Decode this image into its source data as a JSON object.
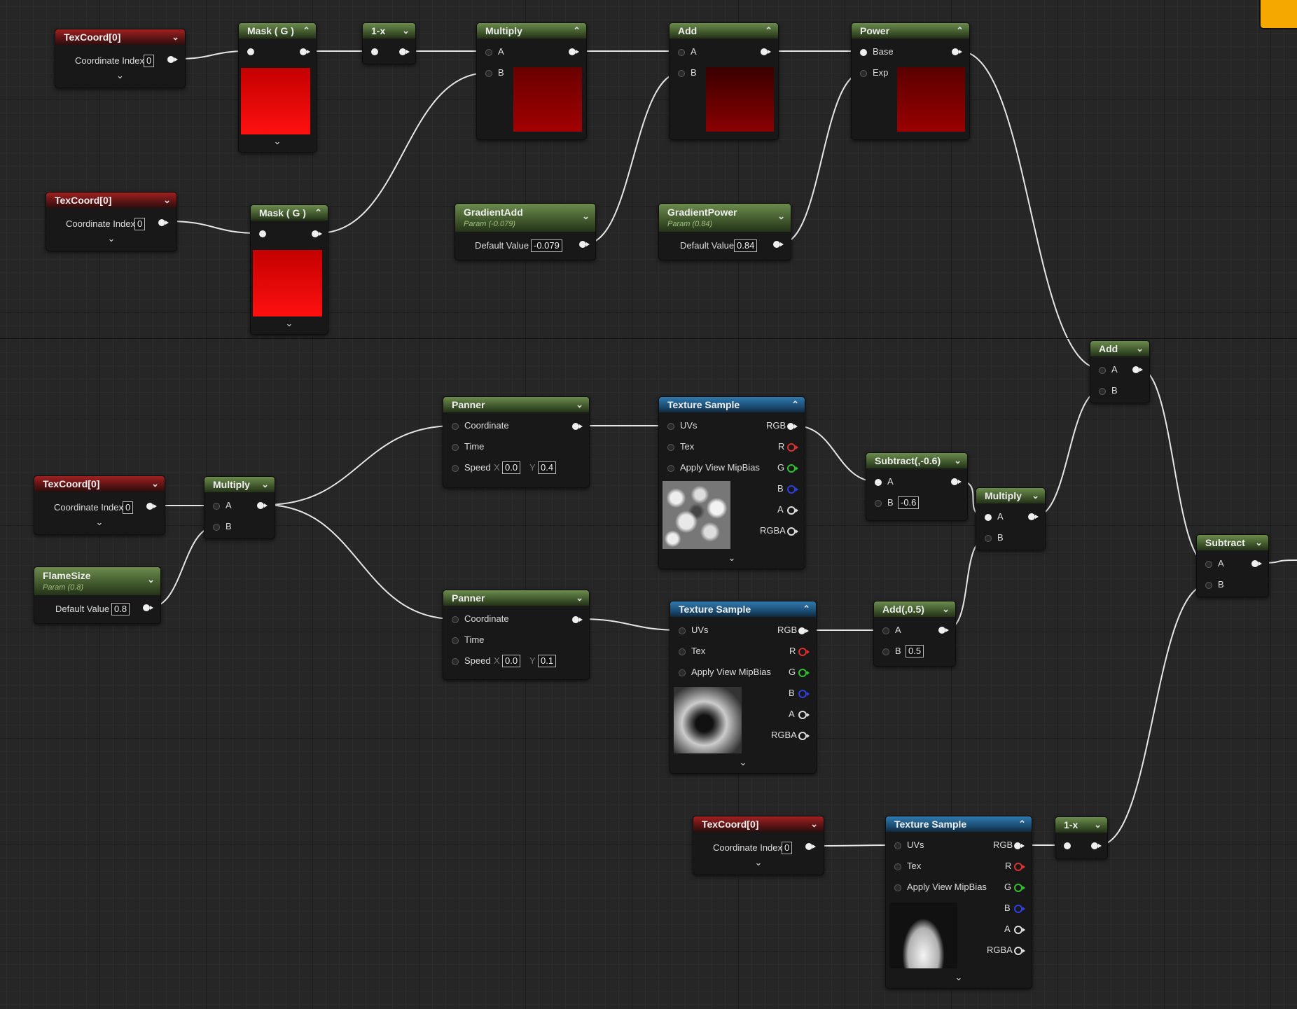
{
  "colors": {
    "accent_swatch": "#f5a800",
    "header_red": "#a12020",
    "header_green": "#6c8c4d",
    "header_blue": "#2f7ab0",
    "wire": "#e6e6e6"
  },
  "icons": {
    "collapse": "chevron-up-icon",
    "dropdown": "chevron-down-icon",
    "expand_preview": "chevron-down-icon"
  },
  "nodes": {
    "texcoord_1": {
      "title": "TexCoord[0]",
      "coordinate_label": "Coordinate Index",
      "coordinate_value": "0"
    },
    "mask_g_1": {
      "title": "Mask ( G )"
    },
    "one_minus_x_1": {
      "title": "1-x"
    },
    "multiply_1": {
      "title": "Multiply",
      "pin_a": "A",
      "pin_b": "B"
    },
    "add_1": {
      "title": "Add",
      "pin_a": "A",
      "pin_b": "B"
    },
    "power_1": {
      "title": "Power",
      "pin_base": "Base",
      "pin_exp": "Exp"
    },
    "texcoord_2": {
      "title": "TexCoord[0]",
      "coordinate_label": "Coordinate Index",
      "coordinate_value": "0"
    },
    "mask_g_2": {
      "title": "Mask ( G )"
    },
    "gradient_add": {
      "title": "GradientAdd",
      "subtitle": "Param (-0.079)",
      "default_label": "Default Value",
      "default_value": "-0.079"
    },
    "gradient_power": {
      "title": "GradientPower",
      "subtitle": "Param (0.84)",
      "default_label": "Default Value",
      "default_value": "0.84"
    },
    "add_2": {
      "title": "Add",
      "pin_a": "A",
      "pin_b": "B"
    },
    "panner_1": {
      "title": "Panner",
      "coordinate": "Coordinate",
      "time": "Time",
      "speed": "Speed",
      "x_label": "X",
      "x_value": "0.0",
      "y_label": "Y",
      "y_value": "0.4"
    },
    "texture_sample_1": {
      "title": "Texture Sample",
      "uvs": "UVs",
      "tex": "Tex",
      "mipbias": "Apply View MipBias",
      "rgb": "RGB",
      "r": "R",
      "g": "G",
      "b": "B",
      "a": "A",
      "rgba": "RGBA"
    },
    "subtract_const": {
      "title": "Subtract(,-0.6)",
      "pin_a": "A",
      "pin_b": "B",
      "b_value": "-0.6"
    },
    "multiply_3": {
      "title": "Multiply",
      "pin_a": "A",
      "pin_b": "B"
    },
    "texcoord_3": {
      "title": "TexCoord[0]",
      "coordinate_label": "Coordinate Index",
      "coordinate_value": "0"
    },
    "multiply_2": {
      "title": "Multiply",
      "pin_a": "A",
      "pin_b": "B"
    },
    "flame_size": {
      "title": "FlameSize",
      "subtitle": "Param (0.8)",
      "default_label": "Default Value",
      "default_value": "0.8"
    },
    "subtract": {
      "title": "Subtract",
      "pin_a": "A",
      "pin_b": "B"
    },
    "panner_2": {
      "title": "Panner",
      "coordinate": "Coordinate",
      "time": "Time",
      "speed": "Speed",
      "x_label": "X",
      "x_value": "0.0",
      "y_label": "Y",
      "y_value": "0.1"
    },
    "texture_sample_2": {
      "title": "Texture Sample",
      "uvs": "UVs",
      "tex": "Tex",
      "mipbias": "Apply View MipBias",
      "rgb": "RGB",
      "r": "R",
      "g": "G",
      "b": "B",
      "a": "A",
      "rgba": "RGBA"
    },
    "add_const": {
      "title": "Add(,0.5)",
      "pin_a": "A",
      "pin_b": "B",
      "b_value": "0.5"
    },
    "texcoord_4": {
      "title": "TexCoord[0]",
      "coordinate_label": "Coordinate Index",
      "coordinate_value": "0"
    },
    "texture_sample_3": {
      "title": "Texture Sample",
      "uvs": "UVs",
      "tex": "Tex",
      "mipbias": "Apply View MipBias",
      "rgb": "RGB",
      "r": "R",
      "g": "G",
      "b": "B",
      "a": "A",
      "rgba": "RGBA"
    },
    "one_minus_x_2": {
      "title": "1-x"
    }
  }
}
